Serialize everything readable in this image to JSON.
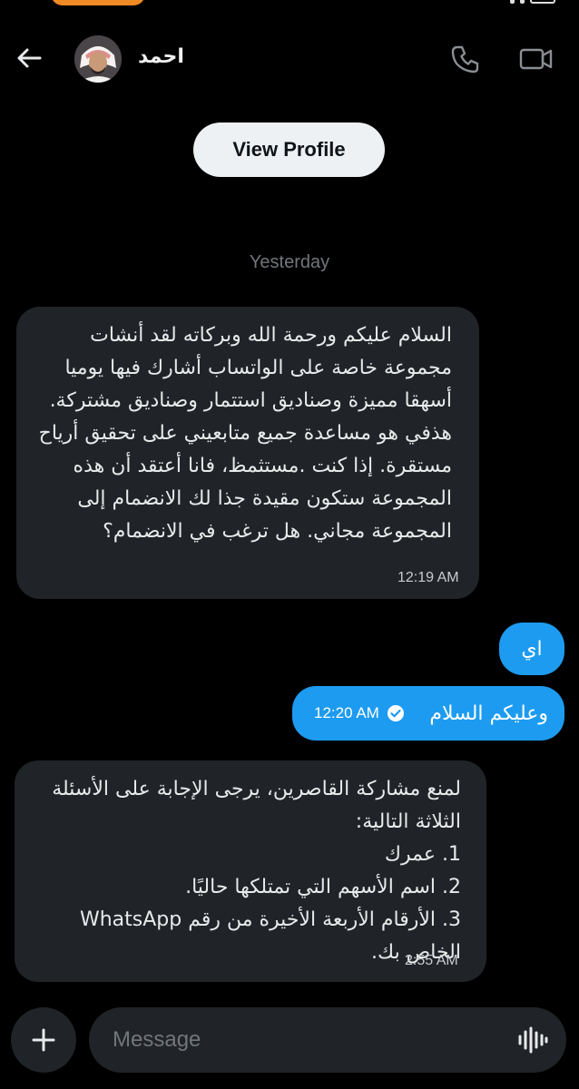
{
  "header": {
    "contact_name": "احمد"
  },
  "view_profile_label": "View Profile",
  "day_separator": "Yesterday",
  "messages": [
    {
      "direction": "incoming",
      "text": "السلام عليكم ورحمة الله وبركاته لقد أنشات مجموعة خاصة على الواتساب أشارك فيها يوميا أسهقا مميزة وصناديق استتمار وصناديق مشتركة. هذفي هو مساعدة جميع متابعيني على تحقيق أرياح مستقرة. إذا كنت .مستثمظ، فانا أعتقد أن هذه المجموعة ستكون مقيدة جذا لك الانضمام إلى المجموعة مجاني. هل ترغب في الانضمام؟",
      "time": "12:19 AM"
    },
    {
      "direction": "outgoing",
      "text": "اي"
    },
    {
      "direction": "outgoing",
      "text": "وعليكم السلام",
      "time": "12:20 AM",
      "status_icon": "check-circle-icon"
    },
    {
      "direction": "incoming",
      "lines": [
        "لمنع مشاركة القاصرين، يرجى الإجابة على الأسئلة الثلاثة التالية:",
        "1. عمرك",
        "2. اسم الأسهم التي تمتلكها حاليًا.",
        "3. الأرقام الأربعة الأخيرة من رقم WhatsApp الخاص بك."
      ],
      "time": "2:55 AM"
    }
  ],
  "composer": {
    "placeholder": "Message"
  },
  "colors": {
    "background": "#000000",
    "incoming_bubble": "#202327",
    "outgoing_bubble": "#1d9bf0",
    "status_pill": "#f08a24"
  },
  "icons": {
    "back": "arrow-left-icon",
    "call": "phone-icon",
    "video": "video-camera-icon",
    "add": "plus-icon",
    "voice": "waveform-icon"
  }
}
